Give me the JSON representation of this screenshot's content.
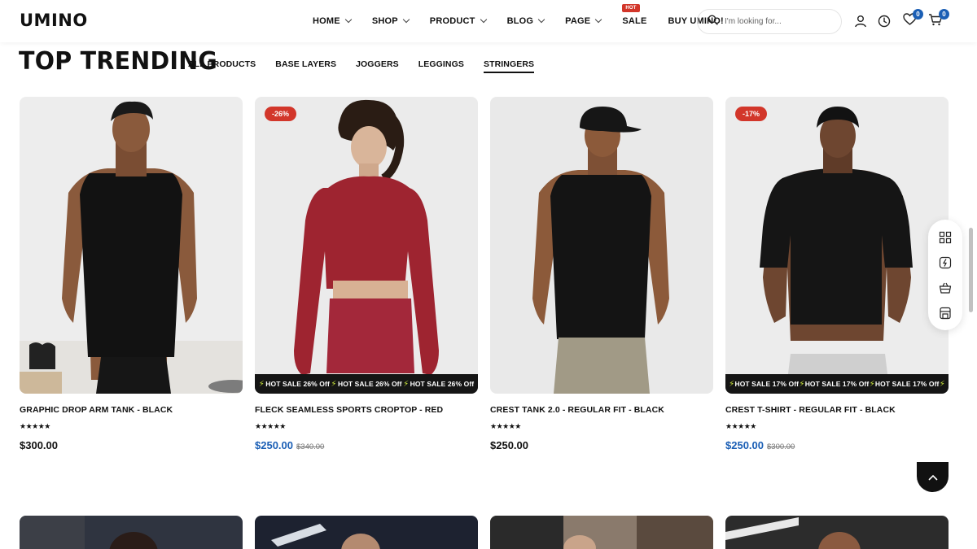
{
  "header": {
    "logo": "UMINO",
    "nav": [
      {
        "label": "HOME",
        "dropdown": true
      },
      {
        "label": "SHOP",
        "dropdown": true
      },
      {
        "label": "PRODUCT",
        "dropdown": true
      },
      {
        "label": "BLOG",
        "dropdown": true
      },
      {
        "label": "PAGE",
        "dropdown": true
      },
      {
        "label": "SALE",
        "dropdown": false,
        "badge": "HOT"
      },
      {
        "label": "BUY UMINO!",
        "dropdown": false
      }
    ],
    "search_placeholder": "I'm looking for...",
    "wishlist_count": "0",
    "cart_count": "0",
    "icons": [
      "search-icon",
      "user-icon",
      "history-icon",
      "heart-icon",
      "cart-icon"
    ]
  },
  "section": {
    "title": "TOP TRENDING",
    "tabs": [
      {
        "label": "ALL PRODUCTS",
        "active": false
      },
      {
        "label": "BASE LAYERS",
        "active": false
      },
      {
        "label": "JOGGERS",
        "active": false
      },
      {
        "label": "LEGGINGS",
        "active": false
      },
      {
        "label": "STRINGERS",
        "active": true
      }
    ]
  },
  "products": [
    {
      "title": "GRAPHIC DROP ARM TANK - BLACK",
      "stars": "★★★★★",
      "price": "$300.00",
      "old_price": "",
      "discount": "",
      "ticker": ""
    },
    {
      "title": "FLECK SEAMLESS SPORTS CROPTOP - RED",
      "stars": "★★★★★",
      "price": "$250.00",
      "old_price": "$340.00",
      "discount": "-26%",
      "ticker": "HOT SALE 26% Off"
    },
    {
      "title": "CREST TANK 2.0 - REGULAR FIT - BLACK",
      "stars": "★★★★★",
      "price": "$250.00",
      "old_price": "",
      "discount": "",
      "ticker": ""
    },
    {
      "title": "CREST T-SHIRT - REGULAR FIT - BLACK",
      "stars": "★★★★★",
      "price": "$250.00",
      "old_price": "$300.00",
      "discount": "-17%",
      "ticker": "HOT SALE 17% Off"
    }
  ],
  "side_tools": [
    "grid-icon",
    "compare-icon",
    "basket-icon",
    "store-icon"
  ],
  "colors": {
    "accent": "#1b5fb5",
    "badge": "#d2362a",
    "ticker_bg": "#151515",
    "bolt": "#c7e33a"
  }
}
